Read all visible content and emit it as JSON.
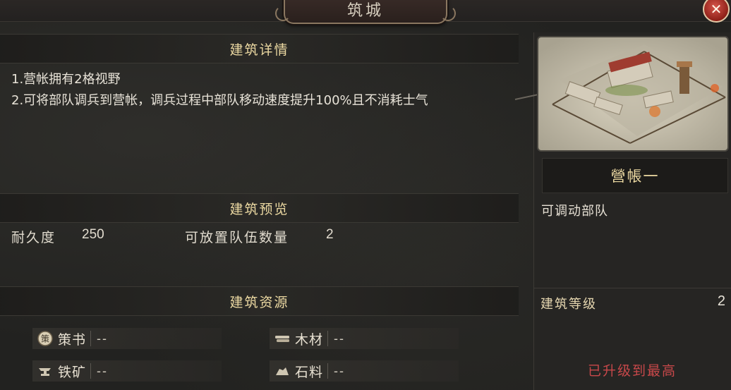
{
  "window": {
    "title": "筑城",
    "close_icon": "close-icon"
  },
  "details": {
    "header": "建筑详情",
    "lines": [
      "1.营帐拥有2格视野",
      "2.可将部队调兵到营帐，调兵过程中部队移动速度提升100%且不消耗士气"
    ]
  },
  "preview_section": {
    "header": "建筑预览",
    "durability_label": "耐久度",
    "durability_value": "250",
    "team_capacity_label": "可放置队伍数量",
    "team_capacity_value": "2"
  },
  "resources": {
    "header": "建筑资源",
    "items": [
      {
        "icon": "strategy-book-icon",
        "label": "策书",
        "value": "--"
      },
      {
        "icon": "wood-icon",
        "label": "木材",
        "value": "--"
      },
      {
        "icon": "iron-anvil-icon",
        "label": "铁矿",
        "value": "--"
      },
      {
        "icon": "stone-icon",
        "label": "石料",
        "value": "--"
      }
    ]
  },
  "building": {
    "image": "camp-building-image",
    "name": "營帳一",
    "description": "可调动部队",
    "level_label": "建筑等级",
    "level_value": "2",
    "status": "已升级到最高"
  },
  "colors": {
    "gold_text": "#ecd9a2",
    "max_level_red": "#c8484a",
    "close_button_red": "#b8362c"
  }
}
